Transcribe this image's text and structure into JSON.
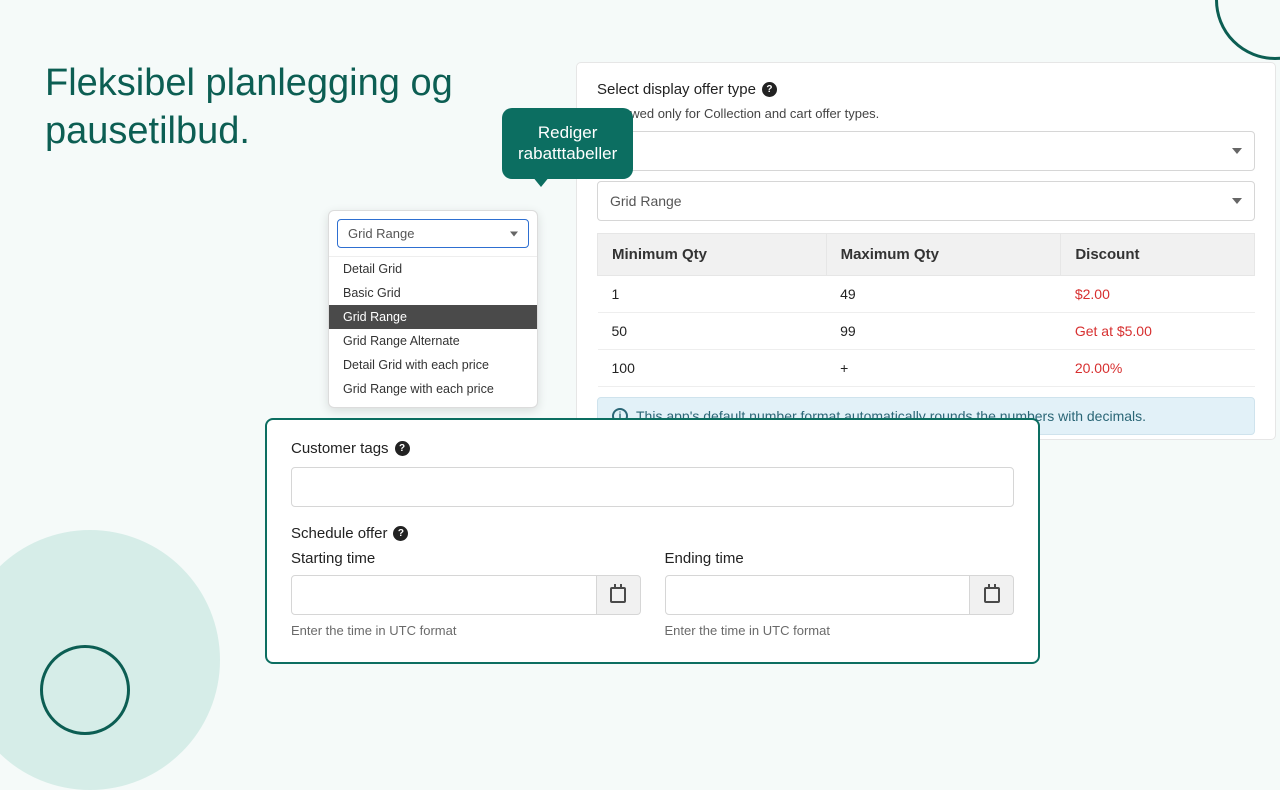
{
  "headline_line1": "Fleksibel planlegging og",
  "headline_line2": "pausetilbud.",
  "bubble_line1": "Rediger",
  "bubble_line2": "rabatttabeller",
  "right": {
    "select_label": "Select display offer type",
    "restriction_prefix": "is allowed only for Collection and cart offer types.",
    "select_value": "Grid Range",
    "headers": {
      "min": "Minimum Qty",
      "max": "Maximum Qty",
      "disc": "Discount"
    },
    "rows": [
      {
        "min": "1",
        "max": "49",
        "disc": "$2.00"
      },
      {
        "min": "50",
        "max": "99",
        "disc": "Get at $5.00"
      },
      {
        "min": "100",
        "max": "+",
        "disc": "20.00%"
      }
    ],
    "info": "This app's default number format automatically rounds the numbers with decimals."
  },
  "dropdown": {
    "selected": "Grid Range",
    "options": [
      "Detail Grid",
      "Basic Grid",
      "Grid Range",
      "Grid Range Alternate",
      "Detail Grid with each price",
      "Grid Range with each price"
    ]
  },
  "bottom": {
    "customer_tags_label": "Customer tags",
    "schedule_label": "Schedule offer",
    "start_label": "Starting time",
    "end_label": "Ending time",
    "utc_hint": "Enter the time in UTC format"
  }
}
